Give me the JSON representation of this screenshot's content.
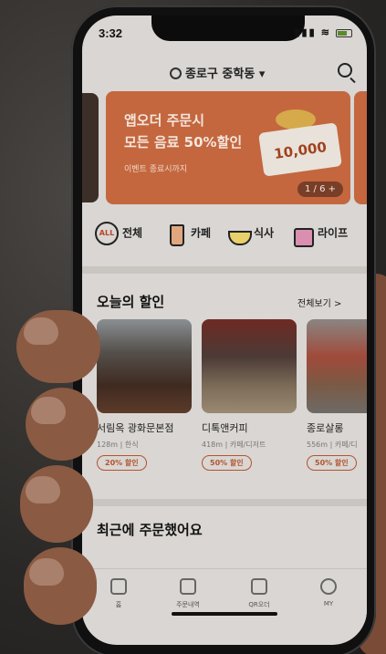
{
  "status": {
    "time": "3:32"
  },
  "header": {
    "location": "종로구 중학동"
  },
  "banner": {
    "headline_line1": "앱오더 주문시",
    "headline_line2": "모든 음료 50%할인",
    "sub": "이벤트 종료시까지",
    "coupon_amount": "10,000",
    "pager": "1 / 6 +"
  },
  "categories": [
    {
      "label": "전체",
      "icon": "all-icon",
      "icon_text": "ALL"
    },
    {
      "label": "카페",
      "icon": "coffee-cup-icon"
    },
    {
      "label": "식사",
      "icon": "rice-bowl-icon"
    },
    {
      "label": "라이프",
      "icon": "shopping-bag-icon"
    }
  ],
  "deals": {
    "title": "오늘의 할인",
    "more": "전체보기 >",
    "items": [
      {
        "name": "서림옥 광화문본점",
        "meta": "128m | 한식",
        "badge": "20% 할인"
      },
      {
        "name": "디톡앤커피",
        "meta": "418m | 카페/디저트",
        "badge": "50% 할인"
      },
      {
        "name": "종로살롱",
        "meta": "556m | 카페/디",
        "badge": "50% 할인"
      }
    ]
  },
  "recent": {
    "title": "최근에 주문했어요"
  },
  "tabs": [
    {
      "label": "홈",
      "icon": "home-icon"
    },
    {
      "label": "주문내역",
      "icon": "receipt-icon"
    },
    {
      "label": "QR오더",
      "icon": "qr-icon"
    },
    {
      "label": "MY",
      "icon": "user-icon"
    }
  ],
  "colors": {
    "accent": "#c4673f",
    "badge": "#b3542f"
  }
}
